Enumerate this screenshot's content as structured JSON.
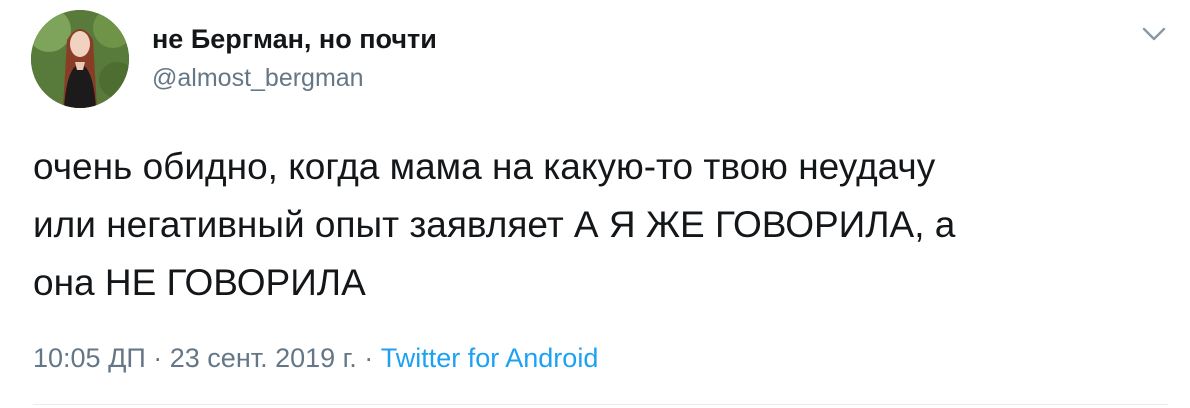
{
  "author": {
    "display_name": "не Бергман, но почти",
    "handle": "@almost_bergman"
  },
  "tweet": {
    "text": "очень обидно, когда мама на какую-то твою неудачу\nили негативный опыт заявляет А Я ЖЕ ГОВОРИЛА, а\nона НЕ ГОВОРИЛА"
  },
  "meta": {
    "time": "10:05 ДП",
    "separator1": " · ",
    "date": "23 сент. 2019 г.",
    "separator2": " · ",
    "source": "Twitter for Android"
  },
  "icons": {
    "more": "chevron-down-icon"
  },
  "colors": {
    "text": "#14171a",
    "secondary": "#657786",
    "link": "#1da1f2"
  }
}
